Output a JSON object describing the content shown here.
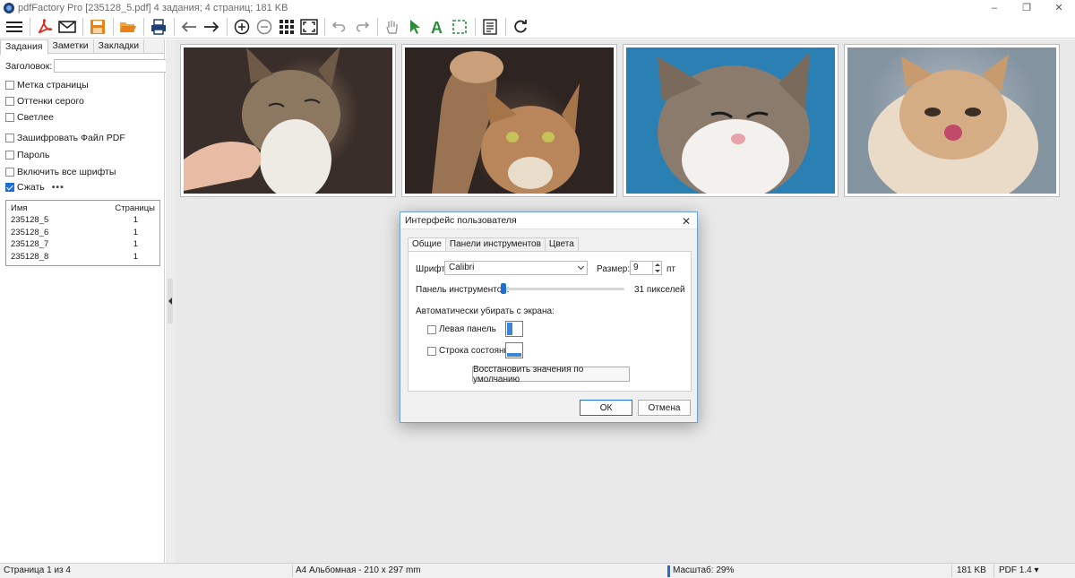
{
  "window": {
    "title": "pdfFactory Pro [235128_5.pdf] 4 задания; 4 страниц; 181 KB",
    "minimize": "–",
    "maximize": "❐",
    "close": "✕"
  },
  "toolbar": {
    "icons": [
      "menu-icon",
      "pdf-icon",
      "mail-icon",
      "save-icon",
      "open-folder-icon",
      "print-icon",
      "arrow-left-icon",
      "arrow-right-icon",
      "zoom-in-icon",
      "zoom-out-icon",
      "grid-view-icon",
      "fit-page-icon",
      "undo-icon",
      "redo-icon",
      "hand-icon",
      "pointer-icon",
      "text-tool-icon",
      "select-rect-icon",
      "properties-icon",
      "refresh-icon"
    ]
  },
  "left_panel": {
    "tabs": [
      "Задания",
      "Заметки",
      "Закладки"
    ],
    "header_label": "Заголовок:",
    "header_value": "",
    "options": [
      {
        "label": "Метка страницы",
        "checked": false
      },
      {
        "label": "Оттенки серого",
        "checked": false
      },
      {
        "label": "Светлее",
        "checked": false
      },
      {
        "label": "Зашифровать Файл PDF",
        "checked": false
      },
      {
        "label": "Пароль",
        "checked": false
      },
      {
        "label": "Включить все шрифты",
        "checked": false
      },
      {
        "label": "Сжать",
        "checked": true
      }
    ],
    "more": "•••",
    "jobs": {
      "col_name": "Имя",
      "col_pages": "Страницы",
      "rows": [
        {
          "name": "235128_5",
          "pages": "1"
        },
        {
          "name": "235128_6",
          "pages": "1"
        },
        {
          "name": "235128_7",
          "pages": "1"
        },
        {
          "name": "235128_8",
          "pages": "1"
        }
      ]
    }
  },
  "dialog": {
    "title": "Интерфейс пользователя",
    "close": "✕",
    "tabs": [
      "Общие",
      "Панели инструментов",
      "Цвета"
    ],
    "font_label": "Шрифт:",
    "font_value": "Calibri",
    "size_label": "Размер:",
    "size_value": "9",
    "size_unit": "пт",
    "toolbar_label": "Панель инструментов:",
    "toolbar_value": "31 пикселей",
    "auto_hide_label": "Автоматически убирать с экрана:",
    "left_panel_label": "Левая панель",
    "status_bar_label": "Строка состояния",
    "restore_button": "Восстановить значения по умолчанию",
    "ok_button": "ОК",
    "cancel_button": "Отмена"
  },
  "status_bar": {
    "page": "Страница 1 из 4",
    "paper": "A4 Альбомная - 210 x 297 mm",
    "zoom": "Масштаб: 29%",
    "size": "181 KB",
    "pdf_version": "PDF 1.4 ▾"
  }
}
